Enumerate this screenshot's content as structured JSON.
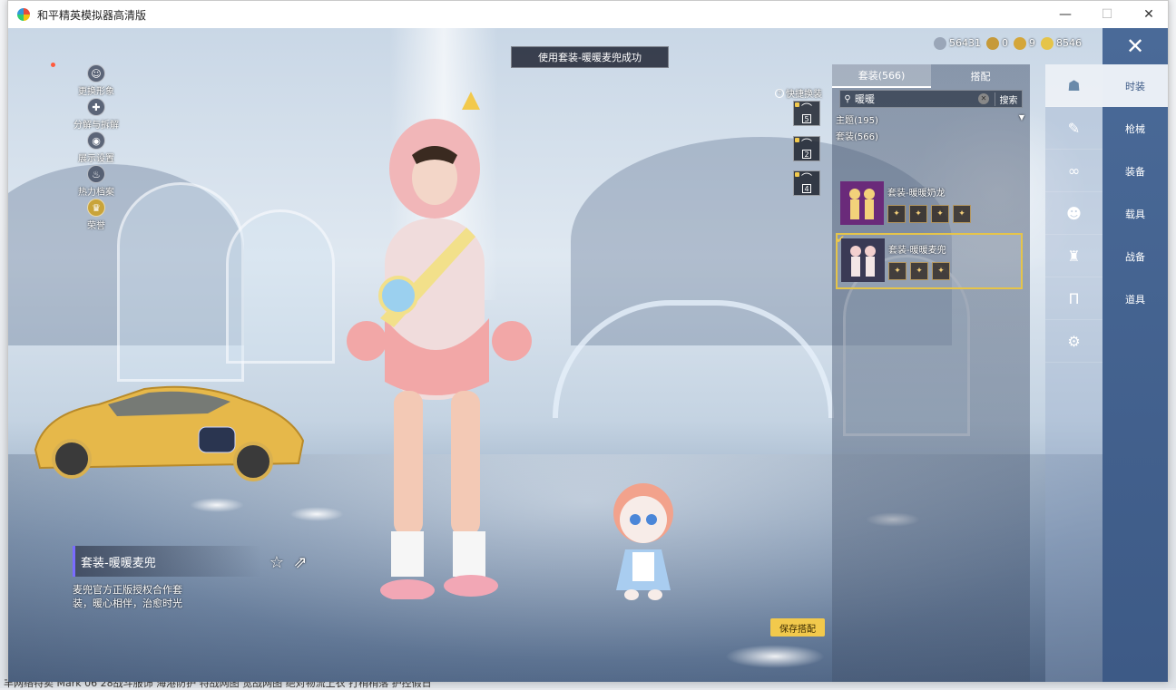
{
  "window": {
    "title": "和平精英模拟器高清版",
    "controls": {
      "minimize": "—",
      "maximize": "☐",
      "close": "✕"
    }
  },
  "desktop": {
    "taskbar_text": "丰网络特卖 Mark 06 28战斗服饰 海港防护 特战网图 宽战网图 绝对物流上衣 打稍稍落 护控假日"
  },
  "left_menu": [
    {
      "label": "更换形象",
      "icon": "avatar-icon"
    },
    {
      "label": "分解与拆解",
      "icon": "puzzle-icon"
    },
    {
      "label": "展示设置",
      "icon": "eye-icon"
    },
    {
      "label": "热力档案",
      "icon": "flame-icon"
    },
    {
      "label": "荣誉",
      "icon": "medal-icon"
    }
  ],
  "toast": "使用套装-暖暖麦兜成功",
  "currency": [
    {
      "icon": "coupon-icon",
      "value": "56431",
      "color": "#9aa6b8"
    },
    {
      "icon": "bronze-coin-icon",
      "value": "0",
      "color": "#c69a3a"
    },
    {
      "icon": "gold-coin-icon",
      "value": "9",
      "color": "#d4a63a"
    },
    {
      "icon": "diamond-icon",
      "value": "8546",
      "color": "#e5c44a"
    }
  ],
  "quick_swap": {
    "label": "快捷换装",
    "slots": [
      "5",
      "2",
      "4"
    ]
  },
  "panel": {
    "tabs": [
      {
        "label": "套装(566)",
        "active": true
      },
      {
        "label": "搭配",
        "active": false
      }
    ],
    "search": {
      "value": "暖暖",
      "button": "搜索"
    },
    "filter_theme": "主题(195)",
    "filter_suit": "套装(566)",
    "cards": [
      {
        "title": "套装-暖暖奶龙",
        "selected": false,
        "pieces": [
          "✦",
          "✦",
          "✦",
          "✦"
        ]
      },
      {
        "title": "套装-暖暖麦兜",
        "selected": true,
        "pieces": [
          "✦",
          "✦",
          "✦"
        ]
      }
    ]
  },
  "right_nav": {
    "close": "✕",
    "icons": [
      "figure-icon",
      "gun-icon",
      "goggles-icon",
      "mask-icon",
      "shirt-icon",
      "pants-icon",
      "shoes-icon"
    ],
    "labels": [
      {
        "label": "时装",
        "active": true
      },
      {
        "label": "枪械",
        "active": false
      },
      {
        "label": "装备",
        "active": false
      },
      {
        "label": "载具",
        "active": false
      },
      {
        "label": "战备",
        "active": false
      },
      {
        "label": "道具",
        "active": false
      }
    ]
  },
  "outfit": {
    "name": "套装-暖暖麦兜",
    "description": "麦兜官方正版授权合作套装，暖心相伴，治愈时光"
  },
  "save_button": "保存搭配",
  "colors": {
    "accent": "#f2c94c",
    "nav": "#4a6a98",
    "selected_border": "#e5c44a"
  }
}
